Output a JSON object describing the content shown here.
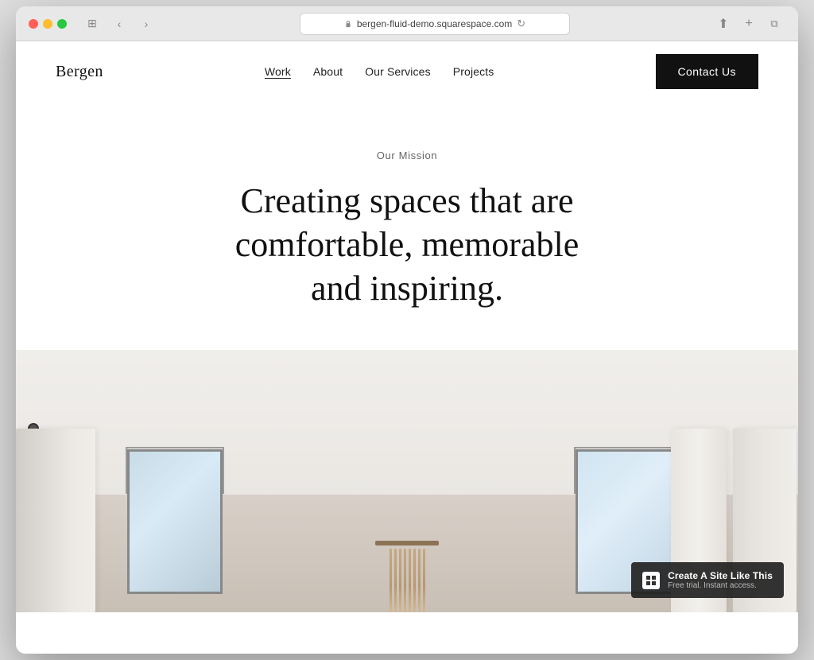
{
  "browser": {
    "url": "bergen-fluid-demo.squarespace.com",
    "reload_icon": "↻"
  },
  "site": {
    "logo": "Bergen",
    "nav": {
      "links": [
        {
          "label": "Work",
          "active": true
        },
        {
          "label": "About",
          "active": false
        },
        {
          "label": "Our Services",
          "active": false
        },
        {
          "label": "Projects",
          "active": false
        }
      ],
      "cta_label": "Contact Us"
    },
    "hero": {
      "section_label": "Our Mission",
      "headline": "Creating spaces that are comfortable, memorable and inspiring."
    },
    "badge": {
      "main": "Create A Site Like This",
      "sub": "Free trial. Instant access."
    }
  }
}
